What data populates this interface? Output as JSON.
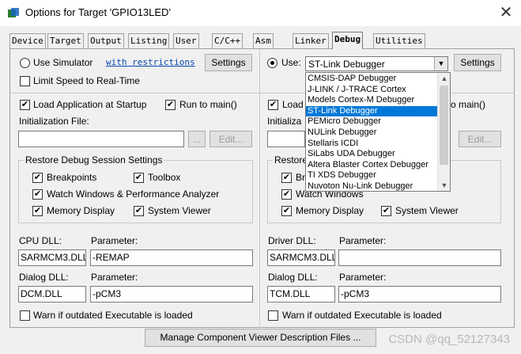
{
  "window": {
    "title": "Options for Target 'GPIO13LED'",
    "close_glyph": "✕"
  },
  "tabs": [
    {
      "label": "Device"
    },
    {
      "label": "Target"
    },
    {
      "label": "Output"
    },
    {
      "label": "Listing"
    },
    {
      "label": "User"
    },
    {
      "label": "C/C++"
    },
    {
      "label": "Asm"
    },
    {
      "label": "Linker"
    },
    {
      "label": "Debug"
    },
    {
      "label": "Utilities"
    }
  ],
  "left": {
    "use_simulator": "Use Simulator",
    "with_restrictions": "with restrictions",
    "settings": "Settings",
    "limit_speed": "Limit Speed to Real-Time",
    "load_app": "Load Application at Startup",
    "run_to_main": "Run to main()",
    "init_file_label": "Initialization File:",
    "init_file_value": "",
    "browse": "...",
    "edit": "Edit...",
    "restore_title": "Restore Debug Session Settings",
    "breakpoints": "Breakpoints",
    "toolbox": "Toolbox",
    "watch_windows": "Watch Windows & Performance Analyzer",
    "memory_display": "Memory Display",
    "system_viewer": "System Viewer",
    "cpu_dll_label": "CPU DLL:",
    "cpu_dll_value": "SARMCM3.DLL",
    "cpu_param_label": "Parameter:",
    "cpu_param_value": "-REMAP",
    "dialog_dll_label": "Dialog DLL:",
    "dialog_dll_value": "DCM.DLL",
    "dialog_param_label": "Parameter:",
    "dialog_param_value": "-pCM3",
    "warn": "Warn if outdated Executable is loaded"
  },
  "right": {
    "use": "Use:",
    "debugger_selected": "ST-Link Debugger",
    "settings": "Settings",
    "load": "Load",
    "run_to_main_partial": "o main()",
    "init_partial": "Initializa",
    "edit": "Edit...",
    "restore_partial": "Restore",
    "breakpoints_partial": "Bre",
    "watch_windows": "Watch Windows",
    "memory_display": "Memory Display",
    "system_viewer": "System Viewer",
    "driver_dll_label": "Driver DLL:",
    "driver_dll_value": "SARMCM3.DLL",
    "driver_param_label": "Parameter:",
    "driver_param_value": "",
    "dialog_dll_label": "Dialog DLL:",
    "dialog_dll_value": "TCM.DLL",
    "dialog_param_label": "Parameter:",
    "dialog_param_value": "-pCM3",
    "warn": "Warn if outdated Executable is loaded"
  },
  "dropdown_items": [
    "CMSIS-DAP Debugger",
    "J-LINK / J-TRACE Cortex",
    "Models Cortex-M Debugger",
    "ST-Link Debugger",
    "PEMicro Debugger",
    "NULink Debugger",
    "Stellaris ICDI",
    "SiLabs UDA Debugger",
    "Altera Blaster Cortex Debugger",
    "TI XDS Debugger",
    "Nuvoton Nu-Link Debugger"
  ],
  "selected_index": 3,
  "check_glyph": "✔",
  "manage_button": "Manage Component Viewer Description Files ...",
  "watermark": "CSDN @qq_52127343",
  "colors": {
    "selection": "#0078d7",
    "link": "#0645ad"
  }
}
